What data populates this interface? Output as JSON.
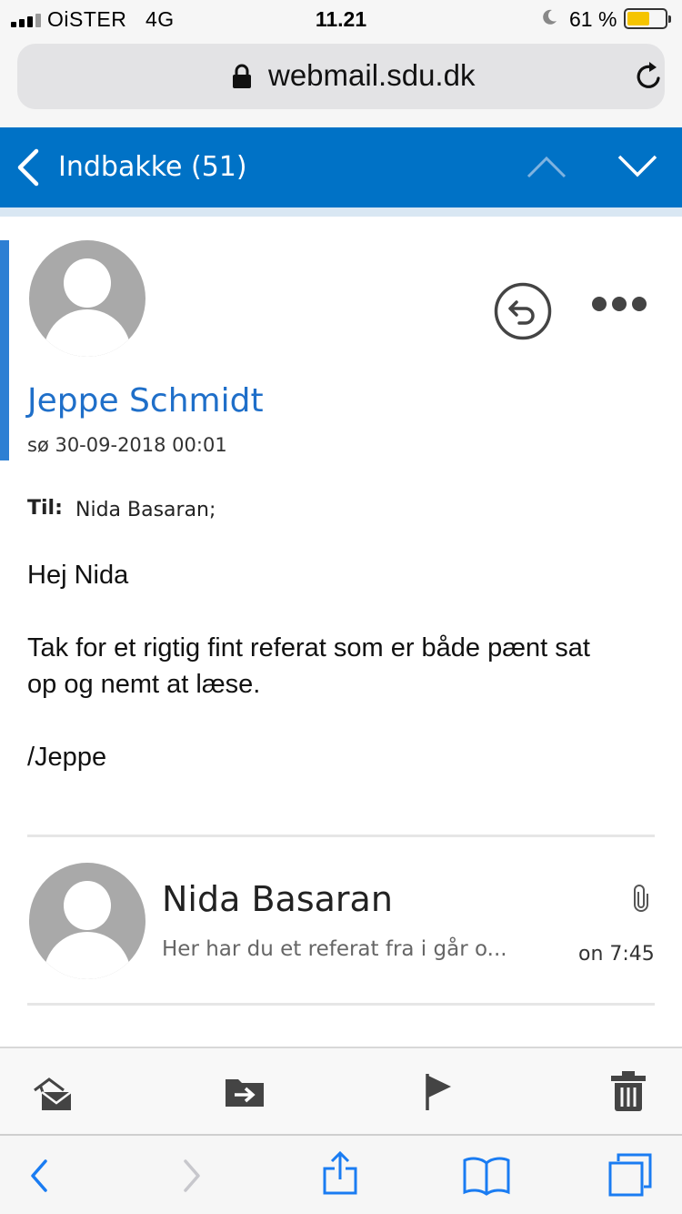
{
  "status_bar": {
    "carrier": "OiSTER   4G",
    "time": "11.21",
    "battery_percent": "61 %",
    "battery_level": 0.61,
    "battery_color": "#f5c400"
  },
  "browser": {
    "url": "webmail.sdu.dk",
    "lock_icon": "lock-icon",
    "reload_icon": "reload-icon"
  },
  "nav": {
    "folder_title": "Indbakke (51)",
    "accent_color": "#0072c6",
    "back_icon": "chevron-left-icon",
    "prev_icon": "chevron-up-icon",
    "next_icon": "chevron-down-icon"
  },
  "message": {
    "sender": "Jeppe Schmidt",
    "date": "sø 30-09-2018 00:01",
    "to_label": "Til:",
    "to_value": "Nida Basaran;",
    "greeting": "Hej Nida",
    "body_line1": "Tak for et rigtig fint referat som er både pænt sat",
    "body_line2": "op og nemt at læse.",
    "signature": "/Jeppe",
    "link_color": "#1f6fc9"
  },
  "thread_item": {
    "sender": "Nida Basaran",
    "preview": "Her har du et referat fra i går o...",
    "time": "on 7:45",
    "attachment_icon": "paperclip-icon"
  },
  "action_toolbar": {
    "icons": [
      "mark-read-icon",
      "move-folder-icon",
      "flag-icon",
      "trash-icon"
    ]
  },
  "safari_toolbar": {
    "icons": [
      "back-icon",
      "forward-icon",
      "share-icon",
      "bookmarks-icon",
      "tabs-icon"
    ],
    "tint_color": "#1a7cf2"
  }
}
